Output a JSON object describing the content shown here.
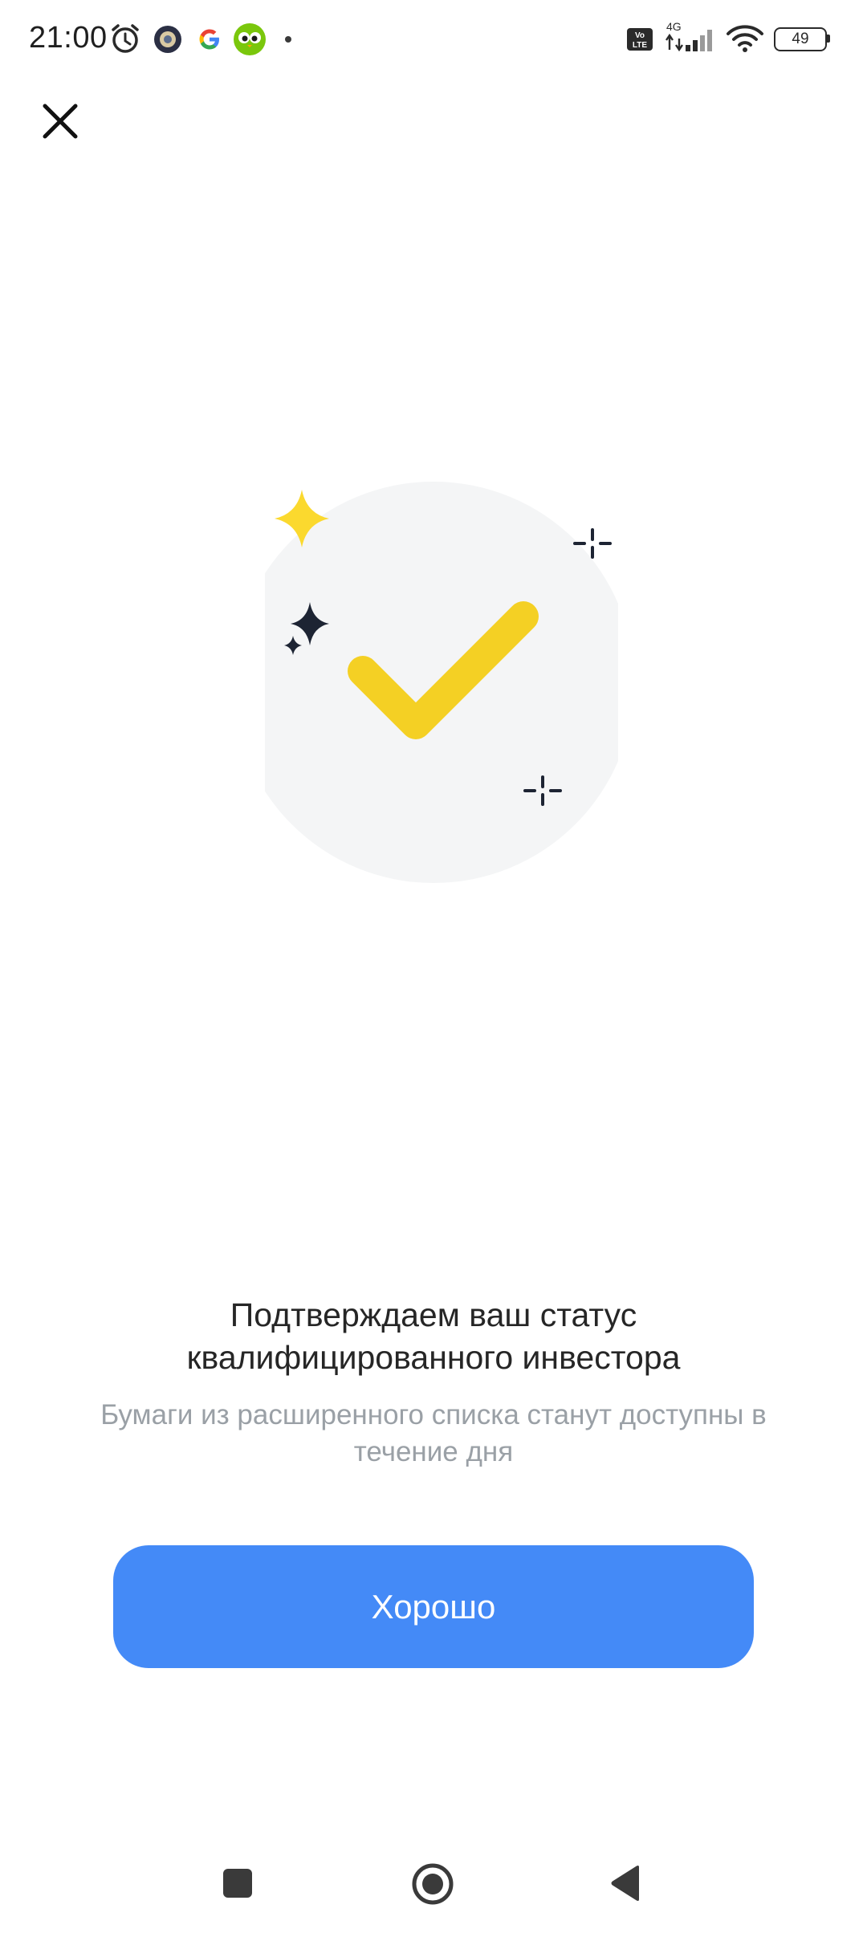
{
  "status_bar": {
    "time": "21:00",
    "battery_level": "49",
    "network": "4G",
    "volte": "Vo LTE",
    "icons": [
      "alarm-icon",
      "app-notification-icon",
      "google-icon",
      "duolingo-icon",
      "more-dot-icon",
      "volte-icon",
      "signal-icon",
      "wifi-icon",
      "battery-icon"
    ]
  },
  "toolbar": {
    "close_icon": "close-icon"
  },
  "illustration": {
    "icon": "checkmark-icon",
    "colors": {
      "circle": "#f4f5f6",
      "check": "#f4d024",
      "sparkle_yellow": "#fbd92e",
      "sparkle_dark": "#1d2433"
    }
  },
  "content": {
    "title": "Подтверждаем ваш статус квалифицированного инвестора",
    "subtitle": "Бумаги из расширенного списка станут доступны в течение дня"
  },
  "actions": {
    "confirm_label": "Хорошо",
    "confirm_color": "#448af7"
  },
  "nav_bar": {
    "icons": [
      "recents-icon",
      "home-icon",
      "back-icon"
    ]
  }
}
